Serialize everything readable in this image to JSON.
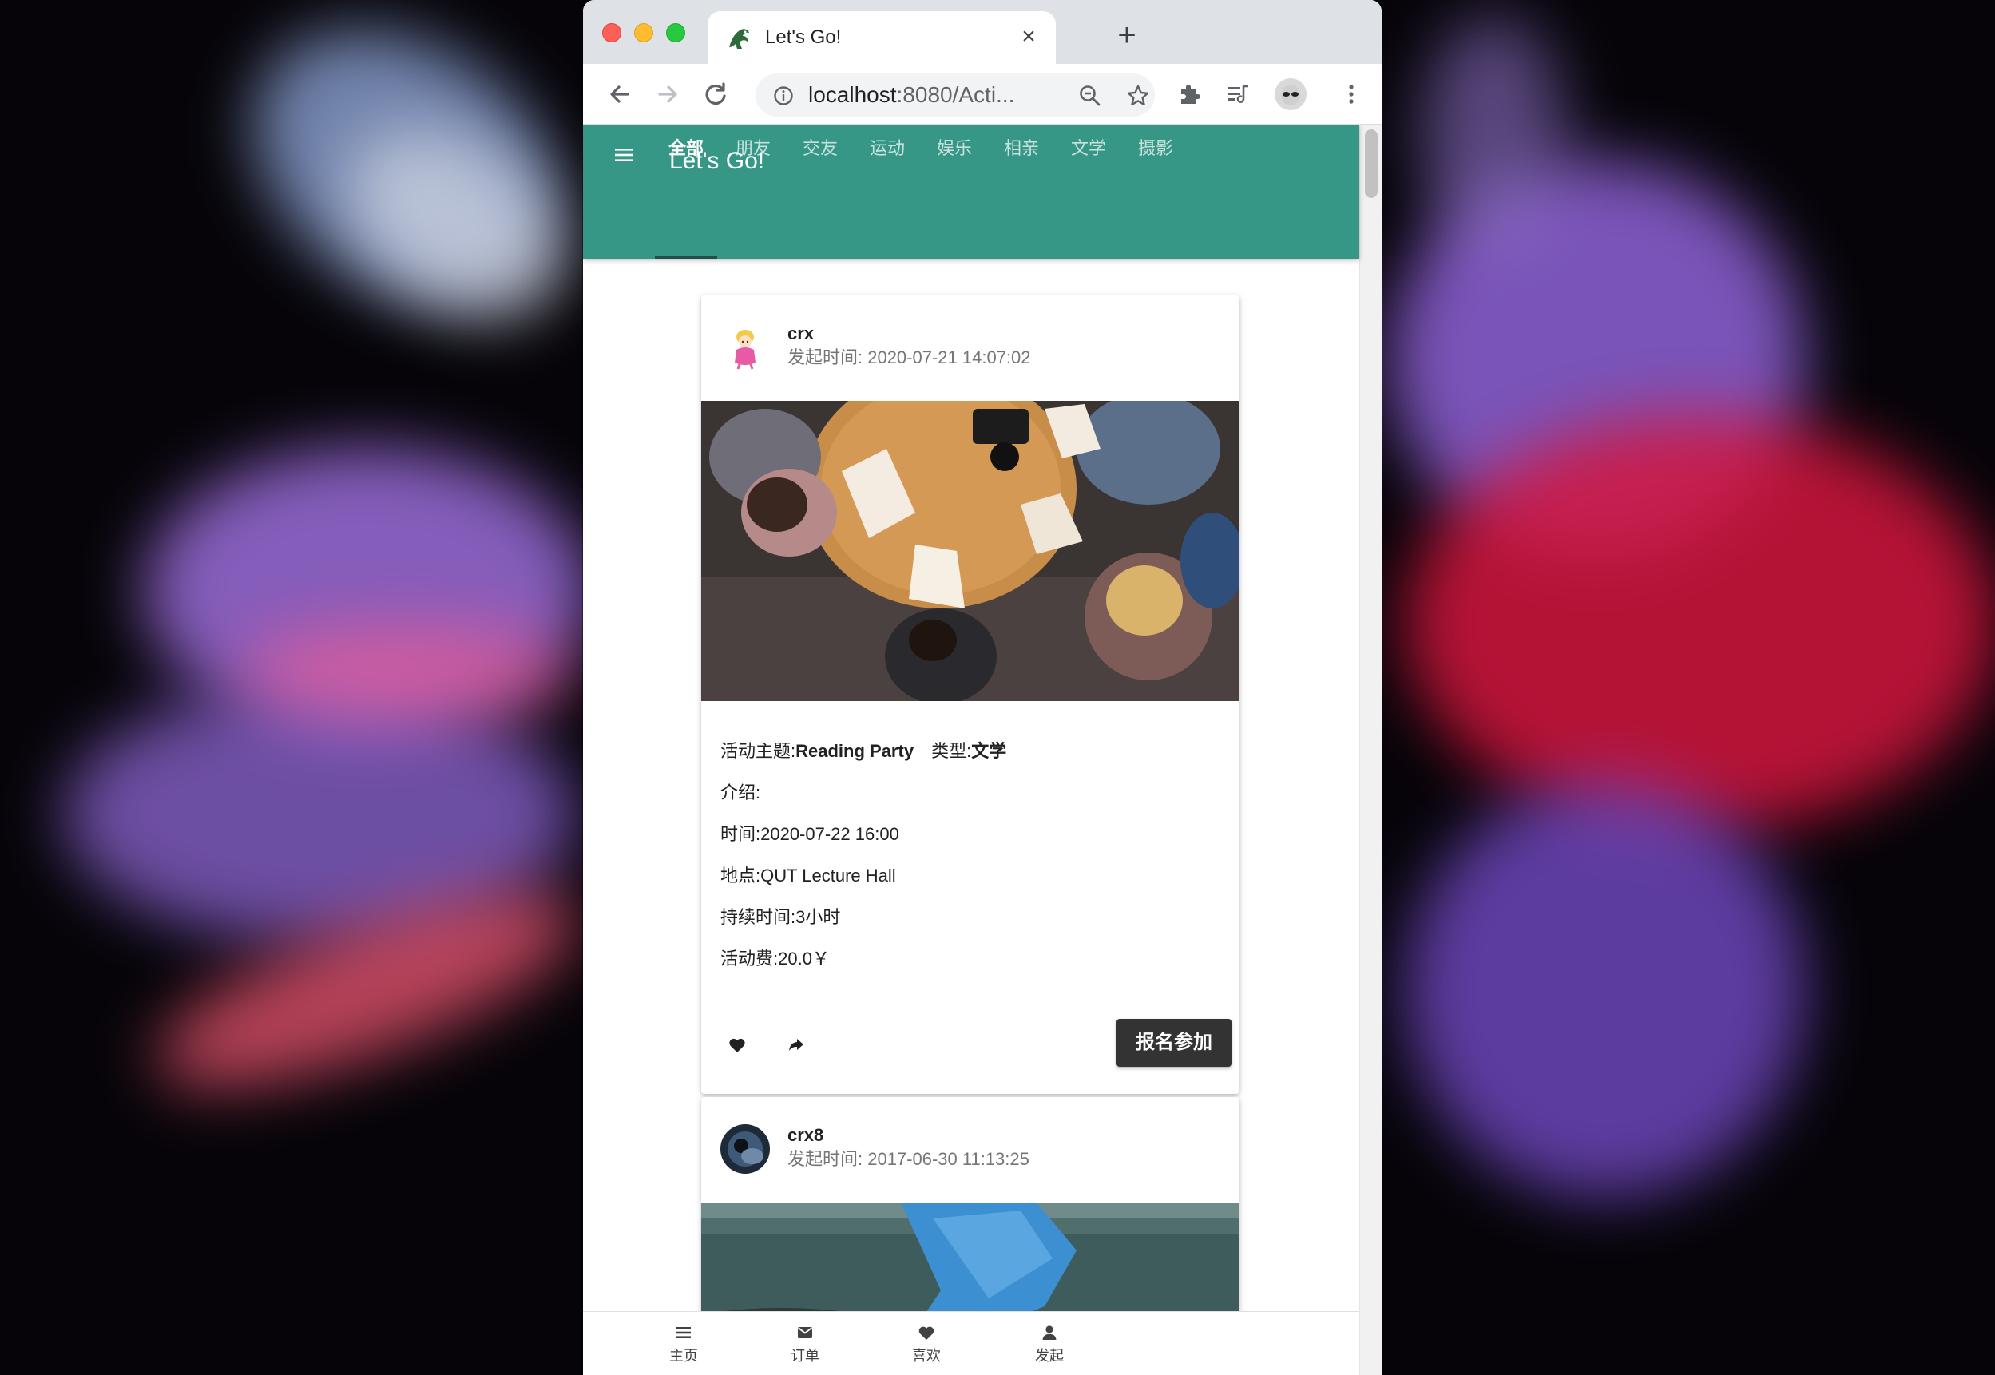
{
  "browser": {
    "tab_title": "Let's Go!",
    "url_host": "localhost",
    "url_rest": ":8080/Acti..."
  },
  "app": {
    "title": "Let's Go!",
    "accent_color": "#379786",
    "categories": [
      "全部",
      "朋友",
      "交友",
      "运动",
      "娱乐",
      "相亲",
      "文学",
      "摄影"
    ],
    "active_category": "全部"
  },
  "posts": [
    {
      "author": "crx",
      "posted": "发起时间: 2020-07-21 14:07:02",
      "theme_label": "活动主题:",
      "theme": "Reading Party",
      "type_label": "类型:",
      "type": "文学",
      "intro": "介绍:",
      "time": "时间:2020-07-22 16:00",
      "location": "地点:QUT Lecture Hall",
      "duration": "持续时间:3小时",
      "fee": "活动费:20.0￥",
      "join_label": "报名参加"
    },
    {
      "author": "crx8",
      "posted": "发起时间: 2017-06-30 11:13:25"
    }
  ],
  "bottom_nav": [
    {
      "label": "主页",
      "icon": "menu-icon"
    },
    {
      "label": "订单",
      "icon": "mail-icon"
    },
    {
      "label": "喜欢",
      "icon": "heart-icon"
    },
    {
      "label": "发起",
      "icon": "person-icon"
    }
  ]
}
